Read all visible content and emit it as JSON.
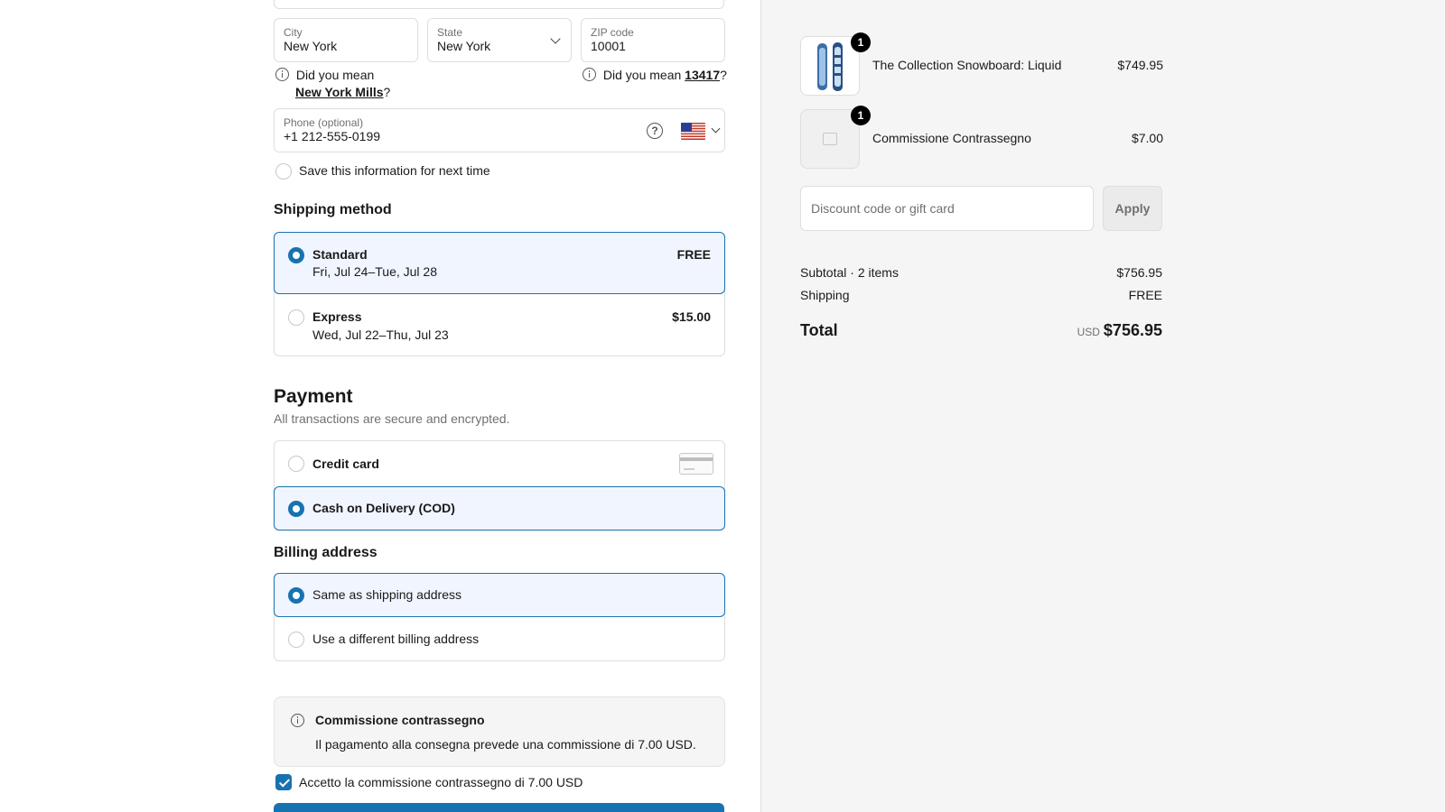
{
  "address": {
    "city": {
      "label": "City",
      "value": "New York"
    },
    "state": {
      "label": "State",
      "value": "New York"
    },
    "zip": {
      "label": "ZIP code",
      "value": "10001"
    },
    "city_hint": {
      "prefix": "Did you mean",
      "suggestion": "New York Mills",
      "suffix": "?"
    },
    "zip_hint": {
      "prefix": "Did you mean",
      "suggestion": "13417",
      "suffix": "?"
    },
    "phone": {
      "label": "Phone (optional)",
      "value": "+1 212-555-0199",
      "country": "US"
    },
    "save_info": {
      "label": "Save this information for next time",
      "checked": false
    }
  },
  "shipping": {
    "title": "Shipping method",
    "options": [
      {
        "title": "Standard",
        "subtitle": "Fri, Jul 24–Tue, Jul 28",
        "price": "FREE",
        "selected": true
      },
      {
        "title": "Express",
        "subtitle": "Wed, Jul 22–Thu, Jul 23",
        "price": "$15.00",
        "selected": false
      }
    ]
  },
  "payment": {
    "title": "Payment",
    "subtitle": "All transactions are secure and encrypted.",
    "options": [
      {
        "title": "Credit card",
        "selected": false
      },
      {
        "title": "Cash on Delivery (COD)",
        "selected": true
      }
    ]
  },
  "billing": {
    "title": "Billing address",
    "options": [
      {
        "label": "Same as shipping address",
        "selected": true
      },
      {
        "label": "Use a different billing address",
        "selected": false
      }
    ]
  },
  "cod_notice": {
    "title": "Commissione contrassegno",
    "text": "Il pagamento alla consegna prevede una commissione di 7.00 USD."
  },
  "cod_accept": {
    "label": "Accetto la commissione contrassegno di 7.00 USD",
    "checked": true
  },
  "summary": {
    "items": [
      {
        "name": "The Collection Snowboard: Liquid",
        "price": "$749.95",
        "qty": "1"
      },
      {
        "name": "Commissione Contrassegno",
        "price": "$7.00",
        "qty": "1"
      }
    ],
    "discount": {
      "placeholder": "Discount code or gift card",
      "apply_label": "Apply"
    },
    "subtotal_label": "Subtotal · 2 items",
    "subtotal_value": "$756.95",
    "shipping_label": "Shipping",
    "shipping_value": "FREE",
    "total_label": "Total",
    "currency": "USD",
    "total_value": "$756.95"
  },
  "colors": {
    "accent": "#1773b0",
    "selected_bg": "#f0f5ff"
  }
}
